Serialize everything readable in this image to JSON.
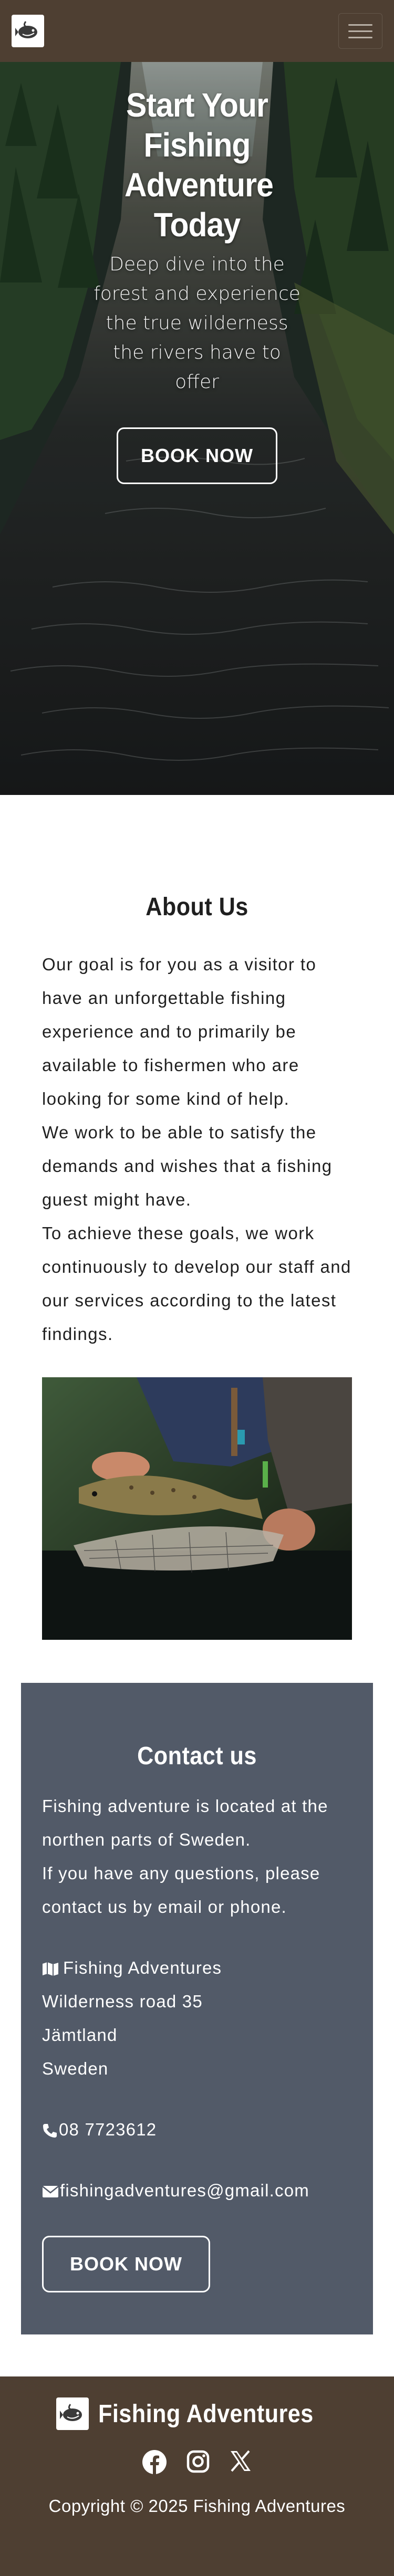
{
  "brand": {
    "name": "Fishing Adventures",
    "logo_icon": "fish-hook-logo-icon"
  },
  "navbar": {
    "menu_icon": "hamburger-menu-icon"
  },
  "hero": {
    "title": "Start Your Fishing Adventure Today",
    "subtitle": "Deep dive into the forest and experience the true wilderness the rivers have to offer",
    "button_label": "BOOK NOW"
  },
  "about": {
    "title": "About Us",
    "paragraphs": [
      "Our goal is for you as a visitor to have an unforgettable fishing experience and to primarily be available to fishermen who are looking for some kind of help.",
      "We work to be able to satisfy the demands and wishes that a fishing guest might have.",
      "To achieve these goals, we work continuously to develop our staff and our services according to the latest findings."
    ]
  },
  "contact": {
    "title": "Contact us",
    "intro": [
      "Fishing adventure is located at the northen parts of Sweden.",
      "If you have any questions, please contact us by email or phone."
    ],
    "address": {
      "name": "Fishing Adventures",
      "street": "Wilderness road 35",
      "region": "Jämtland",
      "country": "Sweden",
      "icon": "map-icon"
    },
    "phone": {
      "value": "08 7723612",
      "icon": "phone-icon"
    },
    "email": {
      "value": "fishingadventures@gmail.com",
      "icon": "envelope-icon"
    },
    "button_label": "BOOK NOW"
  },
  "footer": {
    "brand_name": "Fishing Adventures",
    "socials": [
      "facebook-icon",
      "instagram-icon",
      "x-icon"
    ],
    "copyright": "Copyright © 2025 Fishing Adventures"
  },
  "colors": {
    "nav_bg": "#4e3f32",
    "contact_bg": "#525a68",
    "white": "#ffffff"
  }
}
